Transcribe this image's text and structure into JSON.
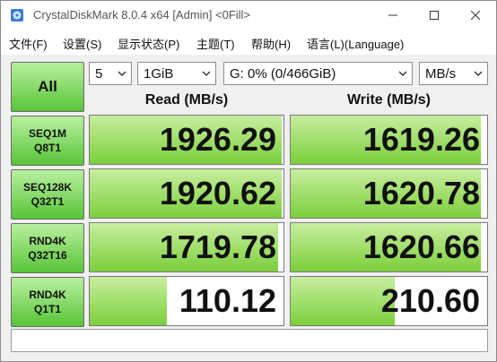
{
  "window": {
    "title": "CrystalDiskMark 8.0.4 x64 [Admin] <0Fill>"
  },
  "menu": [
    "文件(F)",
    "设置(S)",
    "显示状态(P)",
    "主题(T)",
    "帮助(H)",
    "语言(L)(Language)"
  ],
  "controls": {
    "all_label": "All",
    "count": "5",
    "size": "1GiB",
    "drive": "G: 0% (0/466GiB)",
    "unit": "MB/s"
  },
  "headers": {
    "read": "Read (MB/s)",
    "write": "Write (MB/s)"
  },
  "tests": [
    {
      "line1": "SEQ1M",
      "line2": "Q8T1",
      "read": "1926.29",
      "write": "1619.26",
      "read_pct": 0.99,
      "write_pct": 0.97
    },
    {
      "line1": "SEQ128K",
      "line2": "Q32T1",
      "read": "1920.62",
      "write": "1620.78",
      "read_pct": 0.99,
      "write_pct": 0.97
    },
    {
      "line1": "RND4K",
      "line2": "Q32T16",
      "read": "1719.78",
      "write": "1620.66",
      "read_pct": 0.97,
      "write_pct": 0.97
    },
    {
      "line1": "RND4K",
      "line2": "Q1T1",
      "read": "110.12",
      "write": "210.60",
      "read_pct": 0.4,
      "write_pct": 0.53
    }
  ],
  "status_text": "",
  "colors": {
    "green_top": "#b9f0a0",
    "green_bottom": "#58c437",
    "bar_top": "#c8ee9f",
    "bar_bottom": "#7bcf3b"
  }
}
